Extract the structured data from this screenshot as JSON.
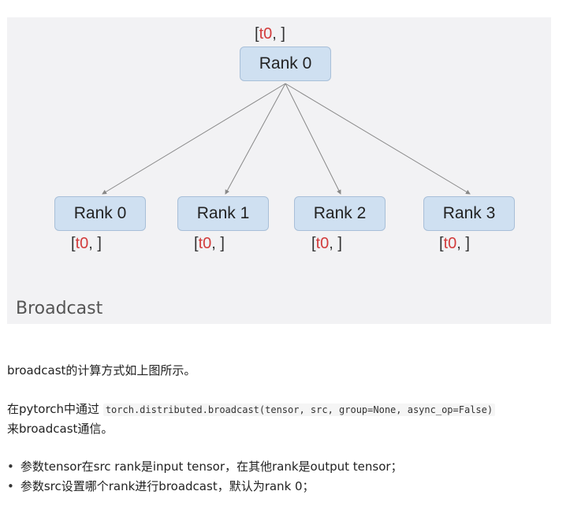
{
  "diagram": {
    "caption": "Broadcast",
    "root": {
      "label": "Rank 0",
      "tensor_open": "[",
      "tensor_val": "t0",
      "tensor_close": ", ]"
    },
    "children": [
      {
        "label": "Rank 0",
        "tensor_open": "[",
        "tensor_val": "t0",
        "tensor_close": ", ]"
      },
      {
        "label": "Rank 1",
        "tensor_open": "[",
        "tensor_val": "t0",
        "tensor_close": ", ]"
      },
      {
        "label": "Rank 2",
        "tensor_open": "[",
        "tensor_val": "t0",
        "tensor_close": ", ]"
      },
      {
        "label": "Rank 3",
        "tensor_open": "[",
        "tensor_val": "t0",
        "tensor_close": ", ]"
      }
    ],
    "colors": {
      "node_fill": "#cfe0f1",
      "node_border": "#a8bfd8",
      "tensor_value": "#d23c3c",
      "edge": "#888888"
    }
  },
  "text": {
    "para1": "broadcast的计算方式如上图所示。",
    "para2_prefix": "在pytorch中通过 ",
    "para2_code": "torch.distributed.broadcast(tensor, src, group=None, async_op=False)",
    "para2_suffix": "来broadcast通信。",
    "bullets": [
      "参数tensor在src rank是input tensor，在其他rank是output tensor；",
      "参数src设置哪个rank进行broadcast，默认为rank 0；"
    ]
  }
}
